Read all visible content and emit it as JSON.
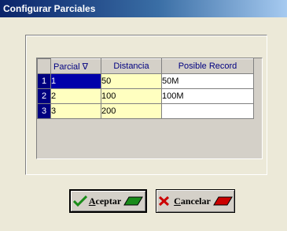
{
  "window": {
    "title": "Configurar Parciales"
  },
  "grid": {
    "columns": [
      "Parcial ∇",
      "Distancia",
      "Posible Record"
    ],
    "rows": [
      {
        "num": "1",
        "parcial": "1",
        "distancia": "50",
        "record": "50M"
      },
      {
        "num": "2",
        "parcial": "2",
        "distancia": "100",
        "record": "100M"
      },
      {
        "num": "3",
        "parcial": "3",
        "distancia": "200",
        "record": ""
      }
    ]
  },
  "buttons": {
    "ok": {
      "accel": "A",
      "rest": "ceptar",
      "icon": "checkmark-icon"
    },
    "cancel": {
      "accel": "C",
      "rest": "ancelar",
      "icon": "x-icon"
    }
  },
  "colors": {
    "title_bg": "#0a246a",
    "row_selector": "#000080",
    "selected_cell": "#0000aa",
    "editable_cell": "#ffffc0",
    "ok_accent": "#1a8c1a",
    "cancel_accent": "#cc0000"
  }
}
